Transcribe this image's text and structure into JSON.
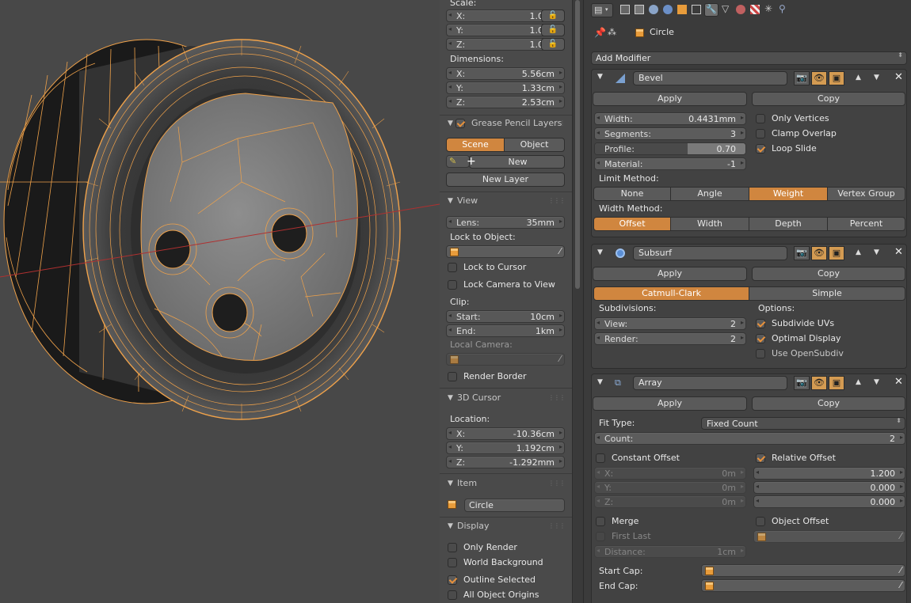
{
  "viewport": {
    "label": "3D Viewport"
  },
  "npanel": {
    "scale": {
      "title": "Scale:",
      "x": {
        "k": "X:",
        "v": "1.000"
      },
      "y": {
        "k": "Y:",
        "v": "1.000"
      },
      "z": {
        "k": "Z:",
        "v": "1.000"
      }
    },
    "dimensions": {
      "title": "Dimensions:",
      "x": {
        "k": "X:",
        "v": "5.56cm"
      },
      "y": {
        "k": "Y:",
        "v": "1.33cm"
      },
      "z": {
        "k": "Z:",
        "v": "2.53cm"
      }
    },
    "grease": {
      "title": "Grease Pencil Layers",
      "scene": "Scene",
      "object": "Object",
      "new": "New",
      "new_layer": "New Layer"
    },
    "view": {
      "title": "View",
      "lens_k": "Lens:",
      "lens_v": "35mm",
      "lock_object": "Lock to Object:",
      "lock_cursor": "Lock to Cursor",
      "lock_camera": "Lock Camera to View",
      "clip": "Clip:",
      "start_k": "Start:",
      "start_v": "10cm",
      "end_k": "End:",
      "end_v": "1km",
      "local_camera": "Local Camera:",
      "render_border": "Render Border"
    },
    "cursor": {
      "title": "3D Cursor",
      "location": "Location:",
      "x": {
        "k": "X:",
        "v": "-10.36cm"
      },
      "y": {
        "k": "Y:",
        "v": "1.192cm"
      },
      "z": {
        "k": "Z:",
        "v": "-1.292mm"
      }
    },
    "item": {
      "title": "Item",
      "name": "Circle"
    },
    "display": {
      "title": "Display",
      "only_render": "Only Render",
      "world_bg": "World Background",
      "outline": "Outline Selected",
      "origins": "All Object Origins"
    }
  },
  "props": {
    "object_name": "Circle",
    "add_modifier": "Add Modifier",
    "bevel": {
      "name": "Bevel",
      "apply": "Apply",
      "copy": "Copy",
      "width_k": "Width:",
      "width_v": "0.4431mm",
      "segments_k": "Segments:",
      "segments_v": "3",
      "profile_k": "Profile:",
      "profile_v": "0.70",
      "profile_frac": 0.7,
      "material_k": "Material:",
      "material_v": "-1",
      "only_vertices": "Only Vertices",
      "clamp_overlap": "Clamp Overlap",
      "loop_slide": "Loop Slide",
      "limit_method": "Limit Method:",
      "limit_opts": [
        "None",
        "Angle",
        "Weight",
        "Vertex Group"
      ],
      "limit_selected": "Weight",
      "width_method": "Width Method:",
      "width_opts": [
        "Offset",
        "Width",
        "Depth",
        "Percent"
      ],
      "width_selected": "Offset"
    },
    "subsurf": {
      "name": "Subsurf",
      "apply": "Apply",
      "copy": "Copy",
      "catmull": "Catmull-Clark",
      "simple": "Simple",
      "subdivisions": "Subdivisions:",
      "view_k": "View:",
      "view_v": "2",
      "render_k": "Render:",
      "render_v": "2",
      "options": "Options:",
      "subdivide_uvs": "Subdivide UVs",
      "optimal_display": "Optimal Display",
      "opensubdiv": "Use OpenSubdiv"
    },
    "array": {
      "name": "Array",
      "apply": "Apply",
      "copy": "Copy",
      "fit_type_k": "Fit Type:",
      "fit_type_v": "Fixed Count",
      "count_k": "Count:",
      "count_v": "2",
      "constant_offset": "Constant Offset",
      "relative_offset": "Relative Offset",
      "cx_k": "X:",
      "cx_v": "0m",
      "cy_k": "Y:",
      "cy_v": "0m",
      "cz_k": "Z:",
      "cz_v": "0m",
      "rx_v": "1.200",
      "ry_v": "0.000",
      "rz_v": "0.000",
      "merge": "Merge",
      "first_last": "First Last",
      "distance_k": "Distance:",
      "distance_v": "1cm",
      "object_offset": "Object Offset",
      "start_cap": "Start Cap:",
      "end_cap": "End Cap:"
    }
  },
  "colors": {
    "accent": "#d0863f",
    "wire": "#f0a24a",
    "axis": "#b03030"
  }
}
